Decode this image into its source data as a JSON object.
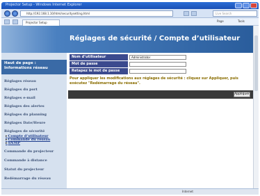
{
  "window": {
    "title": "Projector Setup - Windows Internet Explorer"
  },
  "addressbar": {
    "url": "http://192.168.1.10/html/securitysetting.html",
    "search_placeholder": "Live Search"
  },
  "favbar": {
    "tab_label": "Projector Setup",
    "commands": [
      "Page",
      "Tools"
    ]
  },
  "page": {
    "title": "Réglages de sécurité / Compte d’utilisateur"
  },
  "sidebar": {
    "header": "Haut de page : Informations réseau",
    "items": [
      "Réglages réseau",
      "Réglages du port",
      "Réglages e-mail",
      "Réglages des alertes",
      "Réglages du planning",
      "Réglages Date/Heure",
      "Réglages de sécurité"
    ],
    "subitems": [
      "Compte d’utilisateur",
      "Commande du réseau",
      "SNMP"
    ],
    "items_bottom": [
      "Commande du projecteur",
      "Commande à distance",
      "Statut du projecteur",
      "Redémarrage du réseau"
    ]
  },
  "form": {
    "fields": [
      {
        "label": "Nom d’utilisateur",
        "value": "Administrator"
      },
      {
        "label": "Mot de passe",
        "value": ""
      },
      {
        "label": "Retapez le mot de passe",
        "value": ""
      }
    ],
    "message": "Pour appliquer les modifications aux réglages de sécurité : cliquez sur Appliquer, puis exécutez \"Redémarrage du réseau\".",
    "apply_label": "Appliquer"
  },
  "statusbar": {
    "text": "",
    "zone": "Internet"
  },
  "colors": {
    "banner": "#2a5d9c",
    "label_bg": "#3b4a8e",
    "sidebar_bg": "#d6e1ef",
    "message": "#8a6d00"
  }
}
